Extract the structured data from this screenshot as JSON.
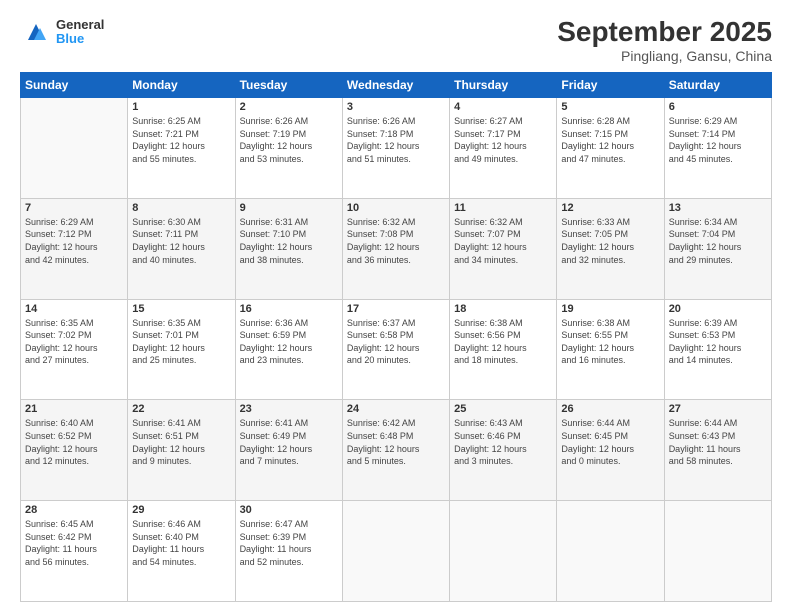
{
  "header": {
    "logo_line1": "General",
    "logo_line2": "Blue",
    "month": "September 2025",
    "location": "Pingliang, Gansu, China"
  },
  "days_of_week": [
    "Sunday",
    "Monday",
    "Tuesday",
    "Wednesday",
    "Thursday",
    "Friday",
    "Saturday"
  ],
  "weeks": [
    [
      {
        "day": "",
        "info": ""
      },
      {
        "day": "1",
        "info": "Sunrise: 6:25 AM\nSunset: 7:21 PM\nDaylight: 12 hours\nand 55 minutes."
      },
      {
        "day": "2",
        "info": "Sunrise: 6:26 AM\nSunset: 7:19 PM\nDaylight: 12 hours\nand 53 minutes."
      },
      {
        "day": "3",
        "info": "Sunrise: 6:26 AM\nSunset: 7:18 PM\nDaylight: 12 hours\nand 51 minutes."
      },
      {
        "day": "4",
        "info": "Sunrise: 6:27 AM\nSunset: 7:17 PM\nDaylight: 12 hours\nand 49 minutes."
      },
      {
        "day": "5",
        "info": "Sunrise: 6:28 AM\nSunset: 7:15 PM\nDaylight: 12 hours\nand 47 minutes."
      },
      {
        "day": "6",
        "info": "Sunrise: 6:29 AM\nSunset: 7:14 PM\nDaylight: 12 hours\nand 45 minutes."
      }
    ],
    [
      {
        "day": "7",
        "info": "Sunrise: 6:29 AM\nSunset: 7:12 PM\nDaylight: 12 hours\nand 42 minutes."
      },
      {
        "day": "8",
        "info": "Sunrise: 6:30 AM\nSunset: 7:11 PM\nDaylight: 12 hours\nand 40 minutes."
      },
      {
        "day": "9",
        "info": "Sunrise: 6:31 AM\nSunset: 7:10 PM\nDaylight: 12 hours\nand 38 minutes."
      },
      {
        "day": "10",
        "info": "Sunrise: 6:32 AM\nSunset: 7:08 PM\nDaylight: 12 hours\nand 36 minutes."
      },
      {
        "day": "11",
        "info": "Sunrise: 6:32 AM\nSunset: 7:07 PM\nDaylight: 12 hours\nand 34 minutes."
      },
      {
        "day": "12",
        "info": "Sunrise: 6:33 AM\nSunset: 7:05 PM\nDaylight: 12 hours\nand 32 minutes."
      },
      {
        "day": "13",
        "info": "Sunrise: 6:34 AM\nSunset: 7:04 PM\nDaylight: 12 hours\nand 29 minutes."
      }
    ],
    [
      {
        "day": "14",
        "info": "Sunrise: 6:35 AM\nSunset: 7:02 PM\nDaylight: 12 hours\nand 27 minutes."
      },
      {
        "day": "15",
        "info": "Sunrise: 6:35 AM\nSunset: 7:01 PM\nDaylight: 12 hours\nand 25 minutes."
      },
      {
        "day": "16",
        "info": "Sunrise: 6:36 AM\nSunset: 6:59 PM\nDaylight: 12 hours\nand 23 minutes."
      },
      {
        "day": "17",
        "info": "Sunrise: 6:37 AM\nSunset: 6:58 PM\nDaylight: 12 hours\nand 20 minutes."
      },
      {
        "day": "18",
        "info": "Sunrise: 6:38 AM\nSunset: 6:56 PM\nDaylight: 12 hours\nand 18 minutes."
      },
      {
        "day": "19",
        "info": "Sunrise: 6:38 AM\nSunset: 6:55 PM\nDaylight: 12 hours\nand 16 minutes."
      },
      {
        "day": "20",
        "info": "Sunrise: 6:39 AM\nSunset: 6:53 PM\nDaylight: 12 hours\nand 14 minutes."
      }
    ],
    [
      {
        "day": "21",
        "info": "Sunrise: 6:40 AM\nSunset: 6:52 PM\nDaylight: 12 hours\nand 12 minutes."
      },
      {
        "day": "22",
        "info": "Sunrise: 6:41 AM\nSunset: 6:51 PM\nDaylight: 12 hours\nand 9 minutes."
      },
      {
        "day": "23",
        "info": "Sunrise: 6:41 AM\nSunset: 6:49 PM\nDaylight: 12 hours\nand 7 minutes."
      },
      {
        "day": "24",
        "info": "Sunrise: 6:42 AM\nSunset: 6:48 PM\nDaylight: 12 hours\nand 5 minutes."
      },
      {
        "day": "25",
        "info": "Sunrise: 6:43 AM\nSunset: 6:46 PM\nDaylight: 12 hours\nand 3 minutes."
      },
      {
        "day": "26",
        "info": "Sunrise: 6:44 AM\nSunset: 6:45 PM\nDaylight: 12 hours\nand 0 minutes."
      },
      {
        "day": "27",
        "info": "Sunrise: 6:44 AM\nSunset: 6:43 PM\nDaylight: 11 hours\nand 58 minutes."
      }
    ],
    [
      {
        "day": "28",
        "info": "Sunrise: 6:45 AM\nSunset: 6:42 PM\nDaylight: 11 hours\nand 56 minutes."
      },
      {
        "day": "29",
        "info": "Sunrise: 6:46 AM\nSunset: 6:40 PM\nDaylight: 11 hours\nand 54 minutes."
      },
      {
        "day": "30",
        "info": "Sunrise: 6:47 AM\nSunset: 6:39 PM\nDaylight: 11 hours\nand 52 minutes."
      },
      {
        "day": "",
        "info": ""
      },
      {
        "day": "",
        "info": ""
      },
      {
        "day": "",
        "info": ""
      },
      {
        "day": "",
        "info": ""
      }
    ]
  ]
}
